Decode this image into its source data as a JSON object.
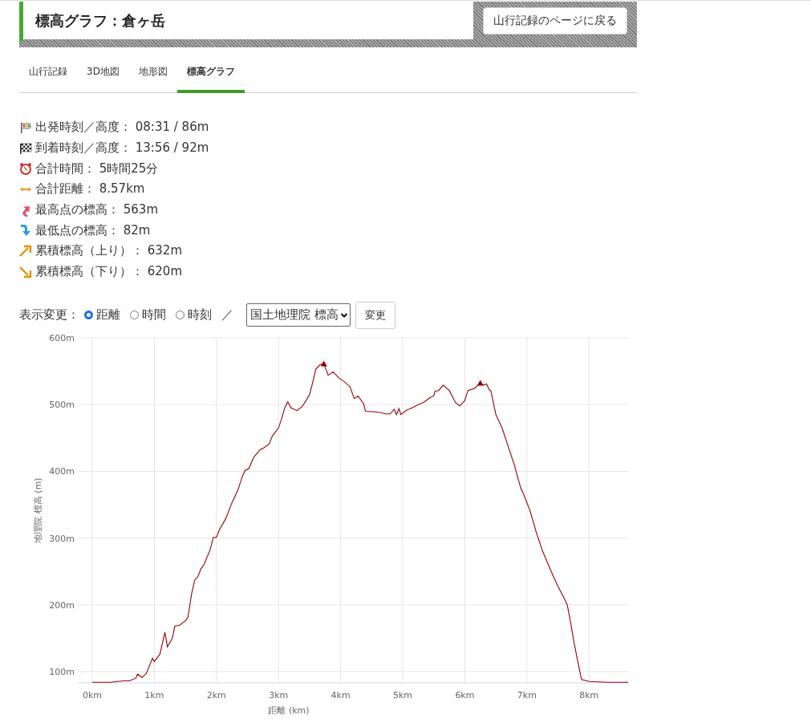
{
  "header": {
    "title": "標高グラフ：倉ヶ岳",
    "back_button": "山行記録のページに戻る"
  },
  "tabs": [
    {
      "label": "山行記録",
      "selected": false
    },
    {
      "label": "3D地図",
      "selected": false
    },
    {
      "label": "地形図",
      "selected": false
    },
    {
      "label": "標高グラフ",
      "selected": true
    }
  ],
  "summary": [
    {
      "kind": "start",
      "text": "出発時刻／高度： 08:31 / 86m"
    },
    {
      "kind": "goal",
      "text": "到着時刻／高度： 13:56 / 92m"
    },
    {
      "kind": "clock",
      "text": "合計時間： 5時間25分"
    },
    {
      "kind": "distance",
      "text": "合計距離： 8.57km"
    },
    {
      "kind": "up",
      "text": "最高点の標高： 563m"
    },
    {
      "kind": "down",
      "text": "最低点の標高： 82m"
    },
    {
      "kind": "ascent",
      "text": "累積標高（上り）： 632m"
    },
    {
      "kind": "descent",
      "text": "累積標高（下り）： 620m"
    }
  ],
  "display_controls": {
    "label": "表示変更：",
    "options": [
      {
        "label": "距離",
        "selected": true
      },
      {
        "label": "時間",
        "selected": false
      },
      {
        "label": "時刻",
        "selected": false
      }
    ],
    "separator": "／",
    "source_select": "国土地理院 標高",
    "apply_button": "変更"
  },
  "chart": {
    "chart_data": {
      "type": "line",
      "grid": true,
      "xlabel": "距離 (km)",
      "ylabel": "地理院 標高 (m)",
      "xlim": [
        0,
        8.63
      ],
      "ylim": [
        83,
        600
      ],
      "xticks": [
        {
          "value": 0,
          "label": "0km"
        },
        {
          "value": 1,
          "label": "1km"
        },
        {
          "value": 2,
          "label": "2km"
        },
        {
          "value": 3,
          "label": "3km"
        },
        {
          "value": 4,
          "label": "4km"
        },
        {
          "value": 5,
          "label": "5km"
        },
        {
          "value": 6,
          "label": "6km"
        },
        {
          "value": 7,
          "label": "7km"
        },
        {
          "value": 8,
          "label": "8km"
        }
      ],
      "yticks": [
        {
          "value": 100,
          "label": "100m"
        },
        {
          "value": 200,
          "label": "200m"
        },
        {
          "value": 300,
          "label": "300m"
        },
        {
          "value": 400,
          "label": "400m"
        },
        {
          "value": 500,
          "label": "500m"
        },
        {
          "value": 600,
          "label": "600m"
        }
      ],
      "x": [
        0,
        0.3,
        0.5,
        0.6,
        0.7,
        0.73,
        0.8,
        0.87,
        0.97,
        1.0,
        1.09,
        1.17,
        1.21,
        1.29,
        1.33,
        1.4,
        1.5,
        1.54,
        1.6,
        1.65,
        1.7,
        1.75,
        1.8,
        1.9,
        1.95,
        2.0,
        2.05,
        2.15,
        2.25,
        2.35,
        2.42,
        2.46,
        2.52,
        2.6,
        2.7,
        2.76,
        2.85,
        2.9,
        3.0,
        3.05,
        3.1,
        3.15,
        3.2,
        3.3,
        3.38,
        3.45,
        3.5,
        3.55,
        3.6,
        3.67,
        3.73,
        3.8,
        3.88,
        3.97,
        4.05,
        4.15,
        4.22,
        4.28,
        4.37,
        4.4,
        4.55,
        4.65,
        4.72,
        4.8,
        4.86,
        4.9,
        4.94,
        4.97,
        5.05,
        5.15,
        5.25,
        5.35,
        5.45,
        5.5,
        5.52,
        5.58,
        5.65,
        5.75,
        5.85,
        5.92,
        6.0,
        6.05,
        6.15,
        6.25,
        6.3,
        6.35,
        6.4,
        6.42,
        6.5,
        6.6,
        6.7,
        6.8,
        6.9,
        6.95,
        7.05,
        7.15,
        7.25,
        7.4,
        7.5,
        7.6,
        7.65,
        7.7,
        7.75,
        7.8,
        7.88,
        8.0,
        8.3,
        8.63
      ],
      "series": [
        {
          "color": "#990000",
          "values": [
            84,
            84,
            86,
            86,
            90,
            96,
            91,
            97,
            120,
            115,
            126,
            159,
            137,
            150,
            168,
            169,
            176,
            181,
            216,
            237,
            242,
            254,
            260,
            283,
            301,
            301,
            313,
            329,
            353,
            373,
            393,
            401,
            404,
            421,
            432,
            435,
            441,
            453,
            465,
            479,
            495,
            504,
            495,
            491,
            497,
            507,
            515,
            533,
            553,
            560,
            561,
            544,
            549,
            540,
            535,
            527,
            509,
            513,
            501,
            490,
            489,
            488,
            486,
            486,
            493,
            485,
            494,
            485,
            491,
            495,
            500,
            504,
            511,
            513,
            520,
            521,
            529,
            521,
            503,
            498,
            506,
            521,
            524,
            532,
            529,
            531,
            521,
            521,
            485,
            465,
            437,
            409,
            375,
            365,
            341,
            309,
            281,
            248,
            228,
            210,
            200,
            176,
            148,
            124,
            88,
            85,
            84,
            84
          ]
        }
      ]
    }
  }
}
